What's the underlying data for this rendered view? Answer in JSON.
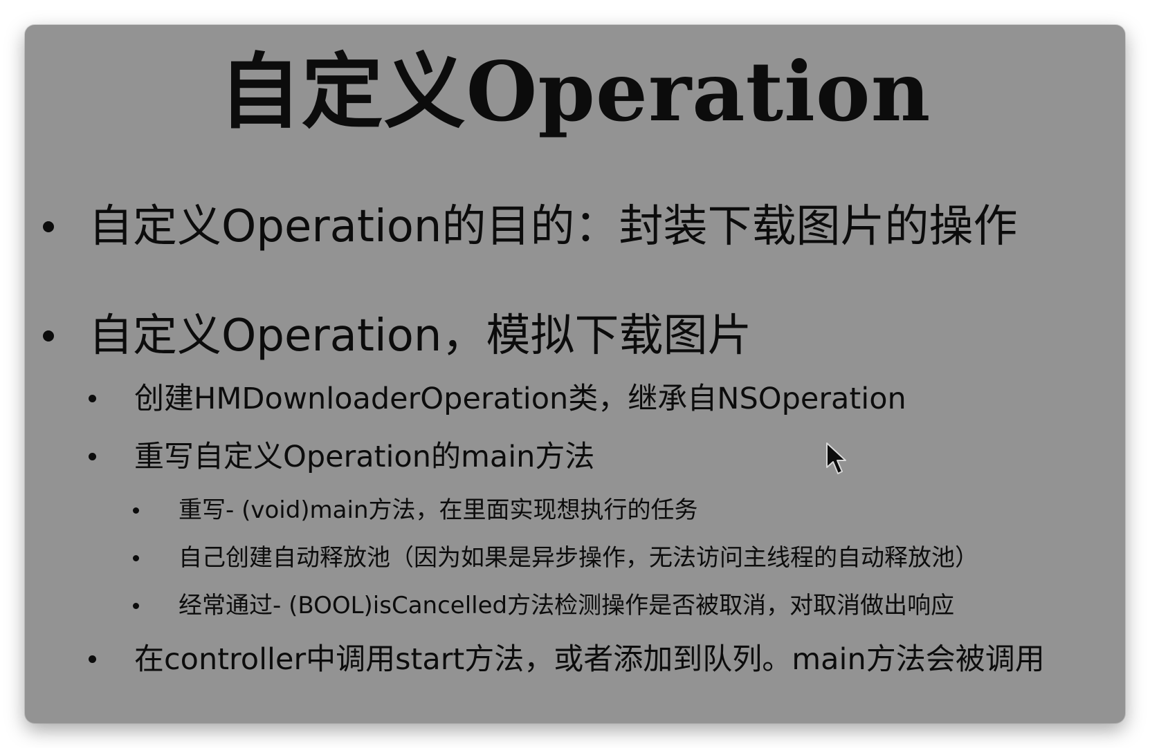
{
  "slide": {
    "title": "自定义Operation",
    "bullets": [
      {
        "level": 1,
        "text": "自定义Operation的目的：封装下载图片的操作"
      },
      {
        "level": 1,
        "text": "自定义Operation，模拟下载图片"
      },
      {
        "level": 2,
        "text": "创建HMDownloaderOperation类，继承自NSOperation"
      },
      {
        "level": 2,
        "text": "重写自定义Operation的main方法"
      },
      {
        "level": 3,
        "text": "重写- (void)main方法，在里面实现想执行的任务"
      },
      {
        "level": 3,
        "text": "自己创建自动释放池（因为如果是异步操作，无法访问主线程的自动释放池）"
      },
      {
        "level": 3,
        "text": "经常通过- (BOOL)isCancelled方法检测操作是否被取消，对取消做出响应"
      },
      {
        "level": 2,
        "text": "在controller中调用start方法，或者添加到队列。main方法会被调用"
      }
    ]
  },
  "colors": {
    "slide_background": "#939393",
    "text": "#0c0c0c"
  },
  "icons": {
    "cursor": "arrow-cursor-icon"
  }
}
